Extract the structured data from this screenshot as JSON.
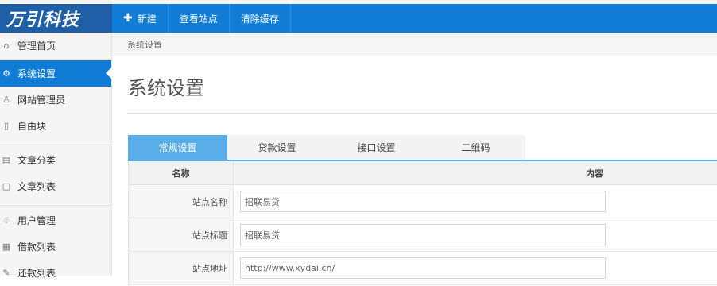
{
  "brand": {
    "logo_text": "万引科技"
  },
  "topbar": {
    "items": [
      {
        "icon": "plus-icon",
        "label": "新建"
      },
      {
        "label": "查看站点"
      },
      {
        "label": "清除缓存"
      }
    ]
  },
  "sidebar": {
    "items": [
      {
        "icon": "home-icon",
        "label": "管理首页"
      },
      {
        "icon": "gear-icon",
        "label": "系统设置",
        "active": true
      },
      {
        "icon": "user-icon",
        "label": "网站管理员"
      },
      {
        "icon": "block-icon",
        "label": "自由块"
      },
      {
        "icon": "folder-icon",
        "label": "文章分类"
      },
      {
        "icon": "document-icon",
        "label": "文章列表"
      },
      {
        "icon": "users-icon",
        "label": "用户管理"
      },
      {
        "icon": "list-icon",
        "label": "借款列表"
      },
      {
        "icon": "edit-icon",
        "label": "还款列表"
      }
    ]
  },
  "breadcrumb": "系统设置",
  "page_title": "系统设置",
  "tabs": [
    {
      "label": "常规设置",
      "active": true
    },
    {
      "label": "贷款设置"
    },
    {
      "label": "接口设置"
    },
    {
      "label": "二维码"
    }
  ],
  "form": {
    "headers": {
      "name": "名称",
      "content": "内容"
    },
    "rows": [
      {
        "label": "站点名称",
        "value": "招联易贷"
      },
      {
        "label": "站点标题",
        "value": "招联易贷"
      },
      {
        "label": "站点地址",
        "value": "http://www.xydai.cn/"
      }
    ]
  },
  "colors": {
    "topbar": "#0f7dd6",
    "logo_bar": "#1f5fa8",
    "tab_active": "#5aaee8"
  }
}
